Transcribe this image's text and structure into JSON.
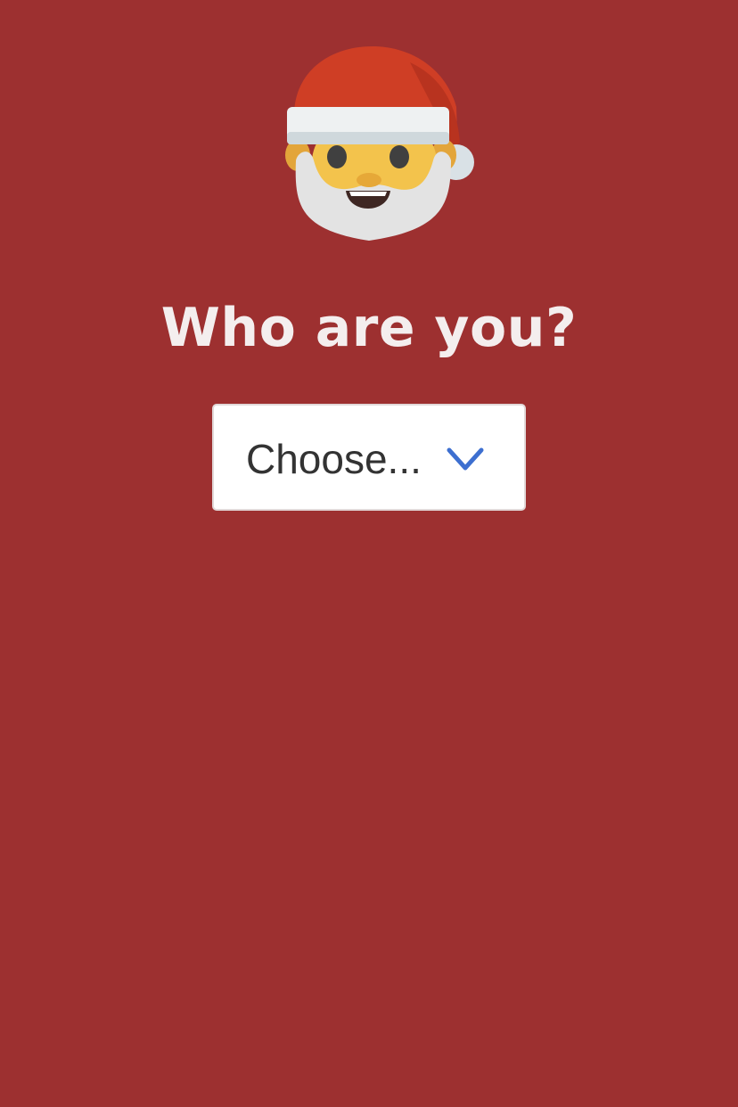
{
  "header": {
    "emoji": "santa-claus-icon",
    "title": "Who are you?"
  },
  "form": {
    "person_select": {
      "selected": "Choose...",
      "icon": "chevron-down-icon",
      "icon_color": "#3d6fd0"
    }
  },
  "colors": {
    "background": "#9d3030",
    "title": "#f4eeee"
  }
}
